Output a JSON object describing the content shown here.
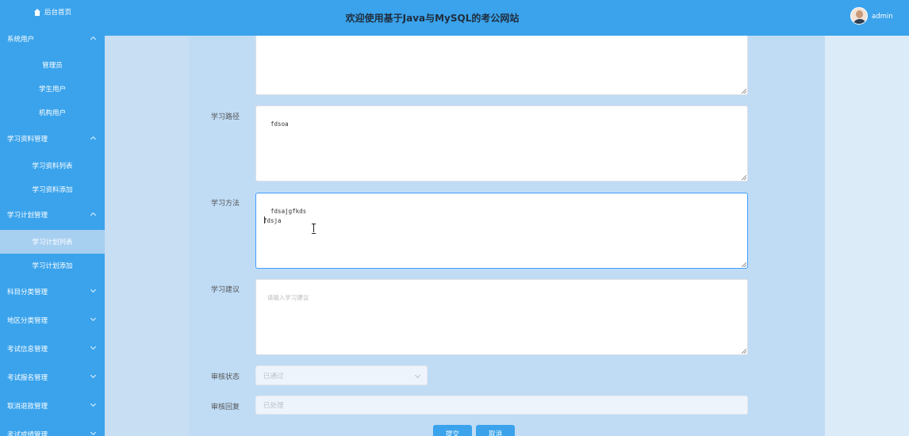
{
  "sidebar": {
    "home": "后台首页",
    "groups": [
      {
        "label": "系统用户",
        "expanded": true,
        "items": [
          "管理员",
          "学生用户",
          "机构用户"
        ]
      },
      {
        "label": "学习资料管理",
        "expanded": true,
        "items": [
          "学习资料列表",
          "学习资料添加"
        ]
      },
      {
        "label": "学习计划管理",
        "expanded": true,
        "items": [
          "学习计划列表",
          "学习计划添加"
        ]
      },
      {
        "label": "科目分类管理",
        "expanded": false
      },
      {
        "label": "地区分类管理",
        "expanded": false
      },
      {
        "label": "考试信息管理",
        "expanded": false
      },
      {
        "label": "考试报名管理",
        "expanded": false
      },
      {
        "label": "取消退款管理",
        "expanded": false
      },
      {
        "label": "考试成绩管理",
        "expanded": false
      }
    ],
    "active_item": "学习计划列表"
  },
  "header": {
    "title": "欢迎使用基于Java与MySQL的考公网站",
    "username": "admin"
  },
  "form": {
    "path_label": "学习路径",
    "path_value": "fdsoa",
    "method_label": "学习方法",
    "method_value": "fdsajgfkds\nfdsja\n",
    "advice_label": "学习建议",
    "advice_placeholder": "请输入学习建议",
    "review_status_label": "审核状态",
    "review_status_value": "已通过",
    "review_reply_label": "审核回复",
    "review_reply_value": "已处理",
    "submit_label": "提交",
    "cancel_label": "取消"
  },
  "colors": {
    "primary": "#3aa3ec",
    "sidebar_active": "#a7cff0",
    "focus_border": "#409eff"
  }
}
